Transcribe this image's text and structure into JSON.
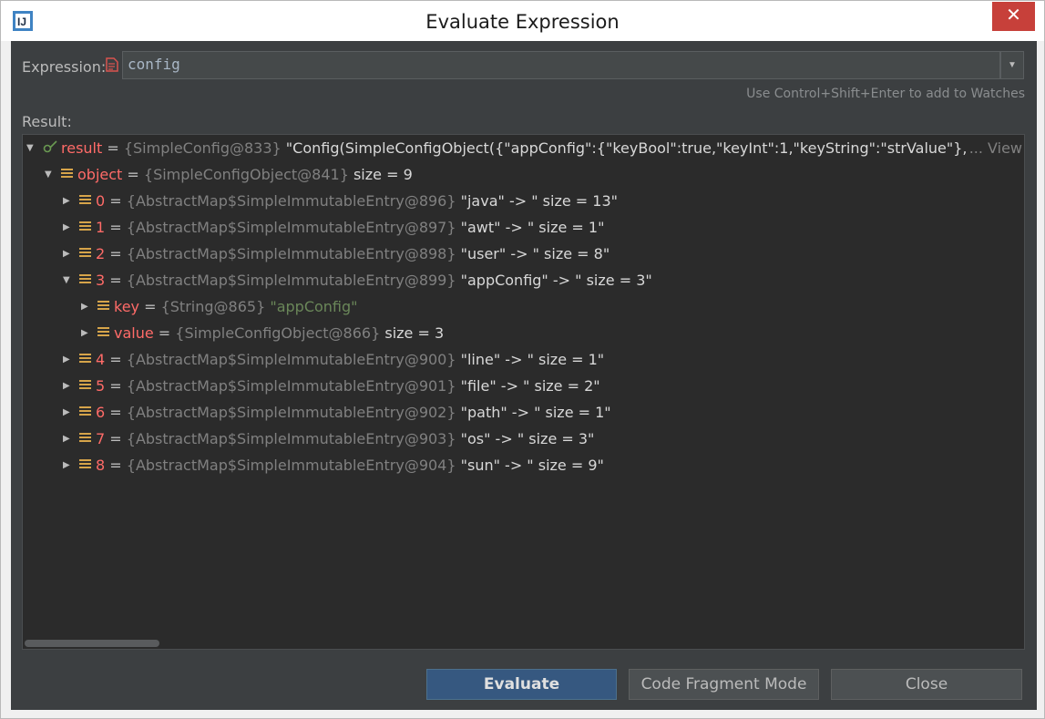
{
  "window": {
    "title": "Evaluate Expression",
    "close_glyph": "✕"
  },
  "expression": {
    "label": "Expression:",
    "value": "config",
    "dropdown_glyph": "▼",
    "hint": "Use Control+Shift+Enter to add to Watches"
  },
  "result": {
    "label": "Result:",
    "rows": [
      {
        "arrow": "▼",
        "icon": "result-icon",
        "name": "result",
        "eq": " = ",
        "ref": "{SimpleConfig@833}",
        "value": " \"Config(SimpleConfigObject({\"appConfig\":{\"keyBool\":true,\"keyInt\":1,\"keyString\":\"strValue\"},\"awt\":{",
        "view": "... View"
      },
      {
        "arrow": "▼",
        "icon": "list-icon",
        "name": "object",
        "eq": " = ",
        "ref": "{SimpleConfigObject@841}",
        "value": "  size = 9"
      },
      {
        "arrow": "▶",
        "icon": "list-icon",
        "name": "0",
        "eq": " = ",
        "ref": "{AbstractMap$SimpleImmutableEntry@896}",
        "value": " \"java\" -> \" size = 13\""
      },
      {
        "arrow": "▶",
        "icon": "list-icon",
        "name": "1",
        "eq": " = ",
        "ref": "{AbstractMap$SimpleImmutableEntry@897}",
        "value": " \"awt\" -> \" size = 1\""
      },
      {
        "arrow": "▶",
        "icon": "list-icon",
        "name": "2",
        "eq": " = ",
        "ref": "{AbstractMap$SimpleImmutableEntry@898}",
        "value": " \"user\" -> \" size = 8\""
      },
      {
        "arrow": "▼",
        "icon": "list-icon",
        "name": "3",
        "eq": " = ",
        "ref": "{AbstractMap$SimpleImmutableEntry@899}",
        "value": " \"appConfig\" -> \" size = 3\""
      },
      {
        "arrow": "▶",
        "icon": "list-icon",
        "name": "key",
        "eq": " = ",
        "ref": "{String@865}",
        "value": "",
        "str": " \"appConfig\""
      },
      {
        "arrow": "▶",
        "icon": "list-icon",
        "name": "value",
        "eq": " = ",
        "ref": "{SimpleConfigObject@866}",
        "value": "  size = 3"
      },
      {
        "arrow": "▶",
        "icon": "list-icon",
        "name": "4",
        "eq": " = ",
        "ref": "{AbstractMap$SimpleImmutableEntry@900}",
        "value": " \"line\" -> \" size = 1\""
      },
      {
        "arrow": "▶",
        "icon": "list-icon",
        "name": "5",
        "eq": " = ",
        "ref": "{AbstractMap$SimpleImmutableEntry@901}",
        "value": " \"file\" -> \" size = 2\""
      },
      {
        "arrow": "▶",
        "icon": "list-icon",
        "name": "6",
        "eq": " = ",
        "ref": "{AbstractMap$SimpleImmutableEntry@902}",
        "value": " \"path\" -> \" size = 1\""
      },
      {
        "arrow": "▶",
        "icon": "list-icon",
        "name": "7",
        "eq": " = ",
        "ref": "{AbstractMap$SimpleImmutableEntry@903}",
        "value": " \"os\" -> \" size = 3\""
      },
      {
        "arrow": "▶",
        "icon": "list-icon",
        "name": "8",
        "eq": " = ",
        "ref": "{AbstractMap$SimpleImmutableEntry@904}",
        "value": " \"sun\" -> \" size = 9\""
      }
    ]
  },
  "buttons": {
    "evaluate": "Evaluate",
    "code_fragment": "Code Fragment Mode",
    "close": "Close"
  },
  "colors": {
    "name": "#ff6b68",
    "reference": "#808080",
    "string": "#6a8759",
    "panel": "#3c3f41",
    "tree": "#2b2b2b",
    "primary_button": "#365880"
  }
}
